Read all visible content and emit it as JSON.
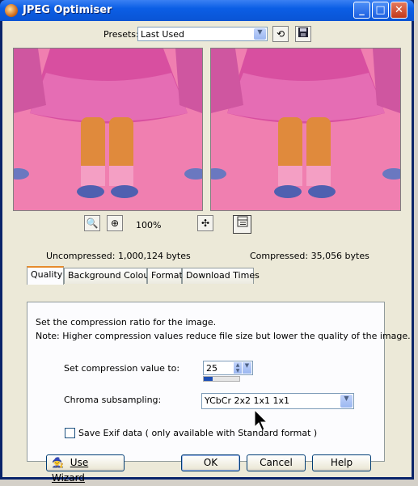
{
  "window": {
    "title": "JPEG Optimiser",
    "min": "_",
    "max": "□",
    "close": "✕"
  },
  "presets": {
    "label": "Presets:",
    "value": "Last Used"
  },
  "zoom": {
    "level": "100%"
  },
  "sizes": {
    "uncompressed": "Uncompressed:  1,000,124 bytes",
    "compressed": "Compressed: 35,056 bytes"
  },
  "tabs": [
    "Quality",
    "Background Colour",
    "Format",
    "Download Times"
  ],
  "quality": {
    "line1": "Set the compression ratio for the image.",
    "line2": "Note:  Higher compression values reduce file size but lower the quality of the image.",
    "compression_label": "Set compression value to:",
    "compression_value": "25",
    "compression_level": 0.25,
    "chroma_label": "Chroma subsampling:",
    "chroma_value": "YCbCr  2x2  1x1  1x1",
    "exif_label": "Save Exif data ( only available with Standard format )",
    "exif_checked": false
  },
  "buttons": {
    "wizard": "Use Wizard",
    "ok": "OK",
    "cancel": "Cancel",
    "help": "Help"
  },
  "colors": {
    "preview_bg": "#f07fb0",
    "tab_highlight": "#e68b2c"
  }
}
